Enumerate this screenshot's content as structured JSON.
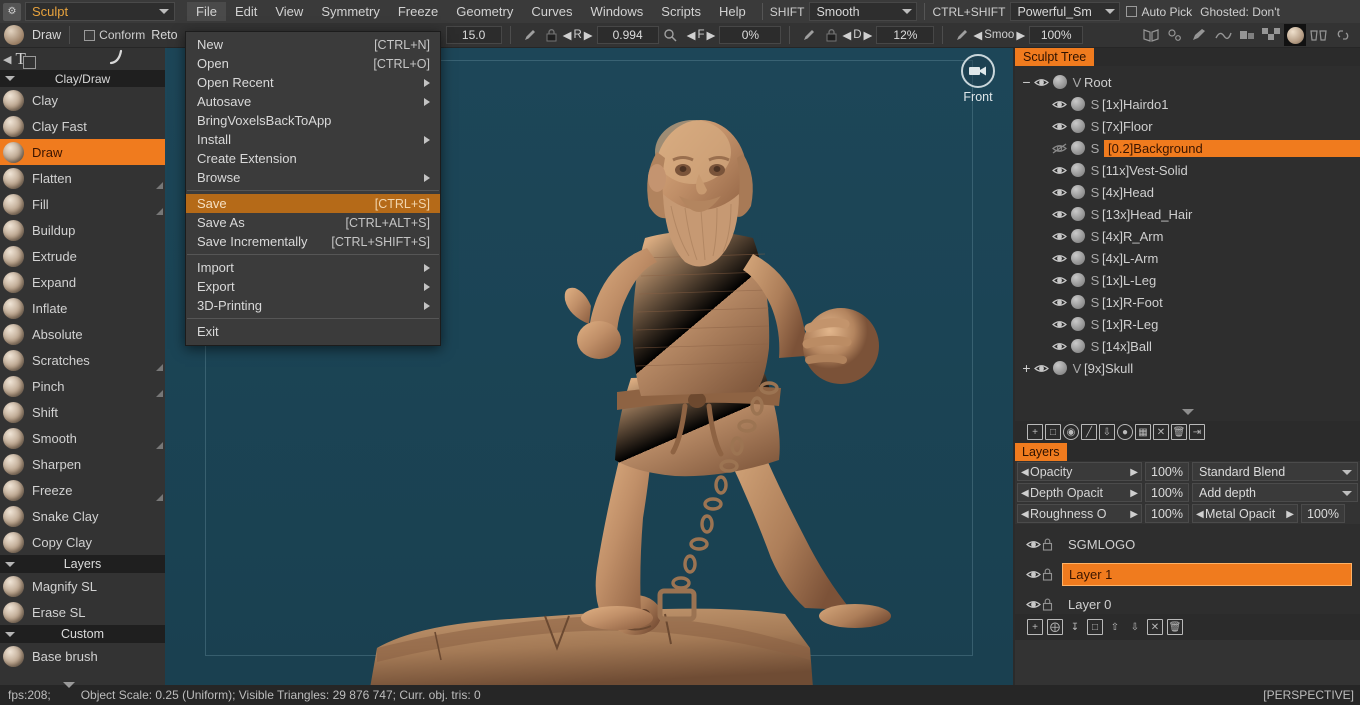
{
  "app": {
    "room_selector": "Sculpt",
    "app_icon": "document-gear-icon"
  },
  "menubar": {
    "items": [
      {
        "label": "File",
        "active": true
      },
      {
        "label": "Edit",
        "active": false
      },
      {
        "label": "View",
        "active": false
      },
      {
        "label": "Symmetry",
        "active": false
      },
      {
        "label": "Freeze",
        "active": false
      },
      {
        "label": "Geometry",
        "active": false
      },
      {
        "label": "Curves",
        "active": false
      },
      {
        "label": "Windows",
        "active": false
      },
      {
        "label": "Scripts",
        "active": false
      },
      {
        "label": "Help",
        "active": false
      }
    ],
    "shift_label": "SHIFT",
    "shift_value": "Smooth",
    "ctrlshift_label": "CTRL+SHIFT",
    "ctrlshift_value": "Powerful_Sm",
    "autopick_label": "Auto Pick",
    "ghosted_label": "Ghosted: Don't"
  },
  "toolbar2": {
    "tool_name": "Draw",
    "conform_label": "Conform",
    "retopo_label": "Reto",
    "size_value": "15.0",
    "r_label": "R",
    "r_value": "0.994",
    "f_label": "F",
    "f_value": "0%",
    "d_label": "D",
    "d_value": "12%",
    "smooth_label": "Smoo",
    "smooth_value": "100%"
  },
  "left_panel": {
    "top_label": "To",
    "groups": [
      {
        "title": "Clay/Draw",
        "tools": [
          {
            "label": "Clay",
            "selected": false,
            "has_corner": false
          },
          {
            "label": "Clay Fast",
            "selected": false,
            "has_corner": false
          },
          {
            "label": "Draw",
            "selected": true,
            "has_corner": false
          },
          {
            "label": "Flatten",
            "selected": false,
            "has_corner": true
          },
          {
            "label": "Fill",
            "selected": false,
            "has_corner": true
          },
          {
            "label": "Buildup",
            "selected": false,
            "has_corner": false
          },
          {
            "label": "Extrude",
            "selected": false,
            "has_corner": false
          },
          {
            "label": "Expand",
            "selected": false,
            "has_corner": false
          },
          {
            "label": "Inflate",
            "selected": false,
            "has_corner": false
          },
          {
            "label": "Absolute",
            "selected": false,
            "has_corner": false
          },
          {
            "label": "Scratches",
            "selected": false,
            "has_corner": true
          },
          {
            "label": "Pinch",
            "selected": false,
            "has_corner": true
          },
          {
            "label": "Shift",
            "selected": false,
            "has_corner": false
          },
          {
            "label": "Smooth",
            "selected": false,
            "has_corner": true
          },
          {
            "label": "Sharpen",
            "selected": false,
            "has_corner": false
          },
          {
            "label": "Freeze",
            "selected": false,
            "has_corner": true
          },
          {
            "label": "Snake Clay",
            "selected": false,
            "has_corner": false
          },
          {
            "label": "Copy Clay",
            "selected": false,
            "has_corner": false
          }
        ]
      },
      {
        "title": "Layers",
        "tools": [
          {
            "label": "Magnify SL",
            "selected": false,
            "has_corner": false
          },
          {
            "label": "Erase SL",
            "selected": false,
            "has_corner": false
          }
        ]
      },
      {
        "title": "Custom",
        "tools": [
          {
            "label": "Base brush",
            "selected": false,
            "has_corner": false
          }
        ]
      }
    ]
  },
  "file_menu": {
    "items": [
      {
        "label": "New",
        "accel": "[CTRL+N]",
        "submenu": false,
        "highlight": false,
        "divider_before": false
      },
      {
        "label": "Open",
        "accel": "[CTRL+O]",
        "submenu": false,
        "highlight": false,
        "divider_before": false
      },
      {
        "label": "Open Recent",
        "accel": "",
        "submenu": true,
        "highlight": false,
        "divider_before": false
      },
      {
        "label": "Autosave",
        "accel": "",
        "submenu": true,
        "highlight": false,
        "divider_before": false
      },
      {
        "label": "BringVoxelsBackToApp",
        "accel": "",
        "submenu": false,
        "highlight": false,
        "divider_before": false
      },
      {
        "label": "Install",
        "accel": "",
        "submenu": true,
        "highlight": false,
        "divider_before": false
      },
      {
        "label": "Create Extension",
        "accel": "",
        "submenu": false,
        "highlight": false,
        "divider_before": false
      },
      {
        "label": "Browse",
        "accel": "",
        "submenu": true,
        "highlight": false,
        "divider_before": false
      },
      {
        "label": "Save",
        "accel": "[CTRL+S]",
        "submenu": false,
        "highlight": true,
        "divider_before": true
      },
      {
        "label": "Save As",
        "accel": "[CTRL+ALT+S]",
        "submenu": false,
        "highlight": false,
        "divider_before": false
      },
      {
        "label": "Save Incrementally",
        "accel": "[CTRL+SHIFT+S]",
        "submenu": false,
        "highlight": false,
        "divider_before": false
      },
      {
        "label": "Import",
        "accel": "",
        "submenu": true,
        "highlight": false,
        "divider_before": true
      },
      {
        "label": "Export",
        "accel": "",
        "submenu": true,
        "highlight": false,
        "divider_before": false
      },
      {
        "label": "3D-Printing",
        "accel": "",
        "submenu": true,
        "highlight": false,
        "divider_before": false
      },
      {
        "label": "Exit",
        "accel": "",
        "submenu": false,
        "highlight": false,
        "divider_before": true
      }
    ]
  },
  "viewport": {
    "camera_label": "Front",
    "camera_icon": "video-camera-icon",
    "background_color": "#1b4455"
  },
  "sculpt_tree": {
    "tab_label": "Sculpt Tree",
    "rows": [
      {
        "indent": 0,
        "expander": "minus",
        "eye": "visible",
        "kind": "V",
        "name": "Root",
        "selected": false
      },
      {
        "indent": 1,
        "expander": "",
        "eye": "visible",
        "kind": "S",
        "name": "[1x]Hairdo1",
        "selected": false
      },
      {
        "indent": 1,
        "expander": "",
        "eye": "visible",
        "kind": "S",
        "name": "[7x]Floor",
        "selected": false
      },
      {
        "indent": 1,
        "expander": "",
        "eye": "hidden",
        "kind": "S",
        "name": "[0.2]Background",
        "selected": true
      },
      {
        "indent": 1,
        "expander": "",
        "eye": "visible",
        "kind": "S",
        "name": "[11x]Vest-Solid",
        "selected": false
      },
      {
        "indent": 1,
        "expander": "",
        "eye": "visible",
        "kind": "S",
        "name": "[4x]Head",
        "selected": false
      },
      {
        "indent": 1,
        "expander": "",
        "eye": "visible",
        "kind": "S",
        "name": "[13x]Head_Hair",
        "selected": false
      },
      {
        "indent": 1,
        "expander": "",
        "eye": "visible",
        "kind": "S",
        "name": "[4x]R_Arm",
        "selected": false
      },
      {
        "indent": 1,
        "expander": "",
        "eye": "visible",
        "kind": "S",
        "name": "[4x]L-Arm",
        "selected": false
      },
      {
        "indent": 1,
        "expander": "",
        "eye": "visible",
        "kind": "S",
        "name": "[1x]L-Leg",
        "selected": false
      },
      {
        "indent": 1,
        "expander": "",
        "eye": "visible",
        "kind": "S",
        "name": "[1x]R-Foot",
        "selected": false
      },
      {
        "indent": 1,
        "expander": "",
        "eye": "visible",
        "kind": "S",
        "name": "[1x]R-Leg",
        "selected": false
      },
      {
        "indent": 1,
        "expander": "",
        "eye": "visible",
        "kind": "S",
        "name": "[14x]Ball",
        "selected": false
      },
      {
        "indent": 0,
        "expander": "plus",
        "eye": "visible",
        "kind": "V",
        "name": "[9x]Skull",
        "selected": false
      }
    ],
    "toolbar_icons": [
      "add-volume-icon",
      "duplicate-icon",
      "sphere-icon",
      "hide-icon",
      "import-icon",
      "clock-icon",
      "grid-icon",
      "export-file-icon",
      "delete-icon",
      "apply-icon"
    ]
  },
  "layers_panel": {
    "tab_label": "Layers",
    "properties": [
      {
        "name": "Opacity",
        "value": "100%",
        "combo": "Standard Blend",
        "combo_type": "dropdown"
      },
      {
        "name": "Depth Opacit",
        "value": "100%",
        "combo": "Add depth",
        "combo_type": "dropdown"
      },
      {
        "name": "Roughness O",
        "value": "100%",
        "combo": "Metal Opacit",
        "combo_type": "spinner",
        "combo_value": "100%"
      }
    ],
    "layers": [
      {
        "name": "SGMLOGO",
        "selected": false,
        "visible": true,
        "locked": false
      },
      {
        "name": "Layer 1",
        "selected": true,
        "visible": true,
        "locked": false
      },
      {
        "name": "Layer 0",
        "selected": false,
        "visible": true,
        "locked": false
      }
    ],
    "toolbar_icons": [
      "add-layer-icon",
      "add-folder-icon",
      "merge-down-icon",
      "duplicate-layer-icon",
      "move-up-icon",
      "move-down-icon",
      "clear-layer-icon",
      "delete-layer-icon"
    ]
  },
  "statusbar": {
    "fps": "fps:208;",
    "info": "Object Scale: 0.25 (Uniform); Visible Triangles: 29 876 747; Curr. obj. tris: 0",
    "projection": "[PERSPECTIVE]"
  }
}
